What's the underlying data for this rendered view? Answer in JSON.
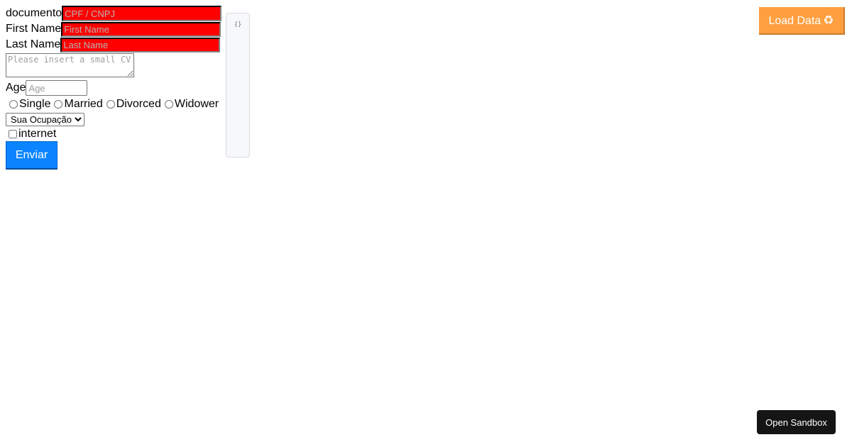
{
  "form": {
    "document": {
      "label": "documento",
      "placeholder": "CPF / CNPJ",
      "value": ""
    },
    "first_name": {
      "label": "First Name",
      "placeholder": "First Name",
      "value": ""
    },
    "last_name": {
      "label": "Last Name",
      "placeholder": "Last Name",
      "value": ""
    },
    "cv": {
      "placeholder": "Please insert a small CV",
      "value": ""
    },
    "age": {
      "label": "Age",
      "placeholder": "Age",
      "value": ""
    },
    "marital_status": {
      "options": [
        "Single",
        "Married",
        "Divorced",
        "Widower"
      ],
      "selected": null
    },
    "occupation": {
      "selected_label": "Sua Ocupação"
    },
    "internet": {
      "label": "internet",
      "checked": false
    },
    "submit_label": "Enviar"
  },
  "json_panel": {
    "text": "{}"
  },
  "load_button": {
    "label": "Load Data",
    "icon": "recycle-icon",
    "icon_glyph": "♻",
    "color": "#ff9f40"
  },
  "sandbox_button": {
    "label": "Open Sandbox"
  },
  "colors": {
    "required_field_bg": "#ff0000",
    "submit_bg": "#0a84ff",
    "sandbox_bg": "#151515"
  }
}
